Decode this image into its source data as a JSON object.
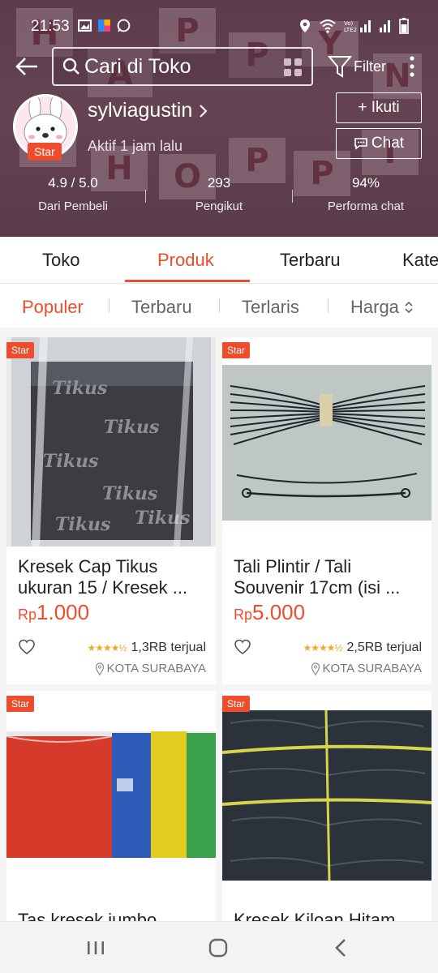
{
  "status_bar": {
    "time": "21:53"
  },
  "search": {
    "placeholder": "Cari di Toko"
  },
  "filter_label": "Filter",
  "shop": {
    "name": "sylviagustin",
    "star_badge": "Star",
    "active": "Aktif 1 jam lalu",
    "follow_label": "+ Ikuti",
    "chat_label": "Chat"
  },
  "stats": [
    {
      "value": "4.9 / 5.0",
      "label": "Dari Pembeli"
    },
    {
      "value": "293",
      "label": "Pengikut"
    },
    {
      "value": "94%",
      "label": "Performa chat"
    }
  ],
  "tabs": [
    "Toko",
    "Produk",
    "Terbaru",
    "Kate"
  ],
  "active_tab": "Produk",
  "sorts": [
    "Populer",
    "Terbaru",
    "Terlaris",
    "Harga"
  ],
  "active_sort": "Populer",
  "products": [
    {
      "badge": "Star",
      "title": "Kresek Cap Tikus ukuran 15 / Kresek ...",
      "currency": "Rp",
      "price": "1.000",
      "sold": "1,3RB terjual",
      "location": "KOTA SURABAYA",
      "rating_stars": 4.5
    },
    {
      "badge": "Star",
      "title": "Tali Plintir / Tali Souvenir 17cm (isi ...",
      "currency": "Rp",
      "price": "5.000",
      "sold": "2,5RB terjual",
      "location": "KOTA SURABAYA",
      "rating_stars": 4.5
    },
    {
      "badge": "Star",
      "title": "Tas kresek jumbo"
    },
    {
      "badge": "Star",
      "title": "Kresek Kiloan Hitam"
    }
  ],
  "colors": {
    "accent": "#ee4d2d",
    "header": "#7b5566"
  },
  "icons": [
    "back-arrow-icon",
    "search-icon",
    "grid-icon",
    "filter-icon",
    "more-icon",
    "chat-icon",
    "heart-icon",
    "location-pin-icon",
    "sort-arrows-icon",
    "recents-icon",
    "home-icon",
    "back-nav-icon"
  ]
}
